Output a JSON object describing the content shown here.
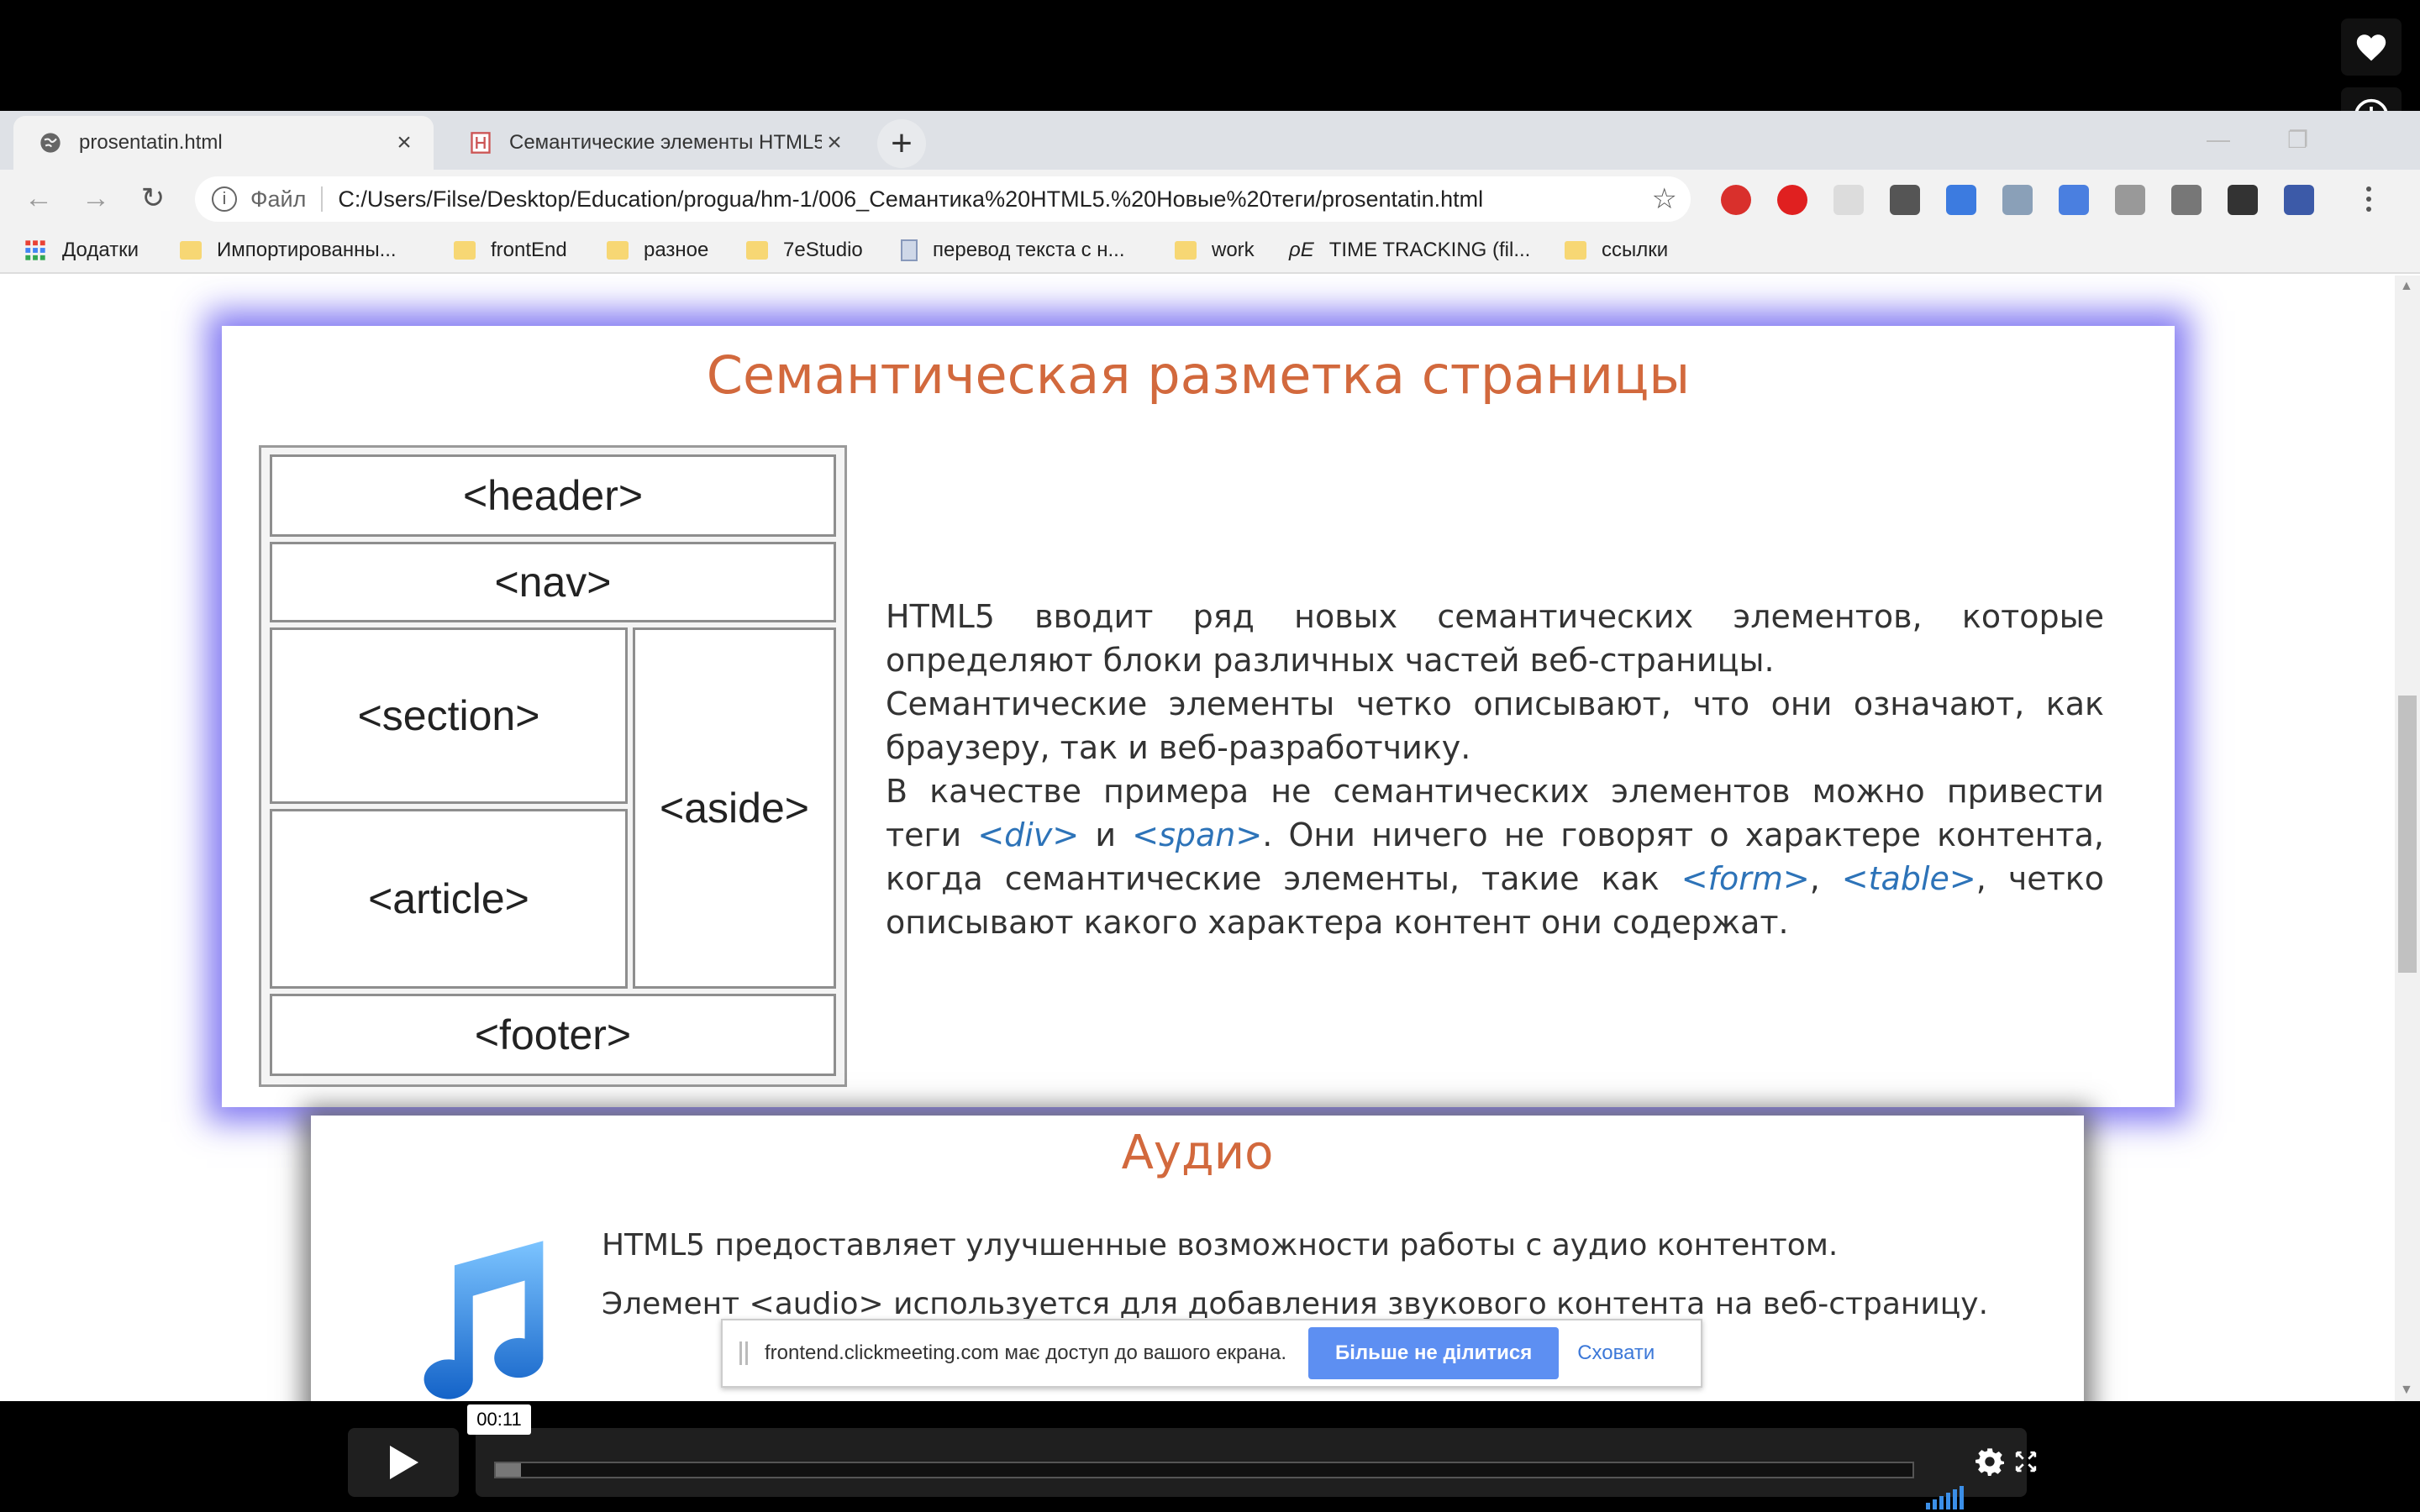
{
  "browser": {
    "tabs": [
      {
        "title": "prosentatin.html",
        "close": "×"
      },
      {
        "title": "Семантические элементы HTML5",
        "close": "×"
      }
    ],
    "new_tab": "+",
    "window_controls": {
      "minimize": "—",
      "restore": "❐"
    },
    "nav": {
      "back": "←",
      "forward": "→",
      "reload": "↻"
    },
    "address": {
      "info": "i",
      "scheme": "Файл",
      "url": "C:/Users/Filse/Desktop/Education/progua/hm-1/006_Семантика%20HTML5.%20Новые%20теги/prosentatin.html",
      "star": "☆"
    },
    "extensions": [
      {
        "name": "adblock-icon",
        "color": "#d9302c"
      },
      {
        "name": "opera-icon",
        "color": "#e02020"
      },
      {
        "name": "ext-grid-icon",
        "color": "#dcdcdc"
      },
      {
        "name": "qr-icon",
        "color": "#555555"
      },
      {
        "name": "translate-icon",
        "color": "#3c7be0"
      },
      {
        "name": "eye-icon",
        "color": "#8aa0b8"
      },
      {
        "name": "google-translate-icon",
        "color": "#4a7fe0"
      },
      {
        "name": "download-icon",
        "color": "#999999"
      },
      {
        "name": "id-icon",
        "color": "#777777"
      },
      {
        "name": "ut-icon",
        "color": "#333333"
      },
      {
        "name": "music-ext-icon",
        "color": "#3c5aa8"
      },
      {
        "name": "menu-icon",
        "color": "#555555"
      }
    ],
    "bookmarks": [
      {
        "label": "Додатки",
        "icon": "apps-icon"
      },
      {
        "label": "Импортированны...",
        "icon": "folder-icon"
      },
      {
        "label": "frontEnd",
        "icon": "folder-icon"
      },
      {
        "label": "разное",
        "icon": "folder-icon"
      },
      {
        "label": "7eStudio",
        "icon": "folder-icon"
      },
      {
        "label": "перевод текста с н...",
        "icon": "page-icon"
      },
      {
        "label": "work",
        "icon": "folder-icon"
      },
      {
        "label": "TIME TRACKING (fil...",
        "icon": "pe-icon",
        "icon_text": "ρE"
      },
      {
        "label": "ссылки",
        "icon": "folder-icon"
      }
    ]
  },
  "slide1": {
    "title": "Семантическая разметка страницы",
    "diagram": {
      "header": "<header>",
      "nav": "<nav>",
      "section": "<section>",
      "aside": "<aside>",
      "article": "<article>",
      "footer": "<footer>"
    },
    "paragraph": {
      "p1": "HTML5 вводит ряд новых семантических элементов, которые определяют блоки различных частей веб-страницы.",
      "p2": "Семантические элементы четко описывают, что они означают, как браузеру, так и веб-разработчику.",
      "p3_a": "В качестве примера не семантических элементов можно привести теги ",
      "tag_div": "<div>",
      "p3_b": " и ",
      "tag_span": "<span>",
      "p3_c": ". Они ничего не говорят о характере контента, когда семантические элементы, такие как ",
      "tag_form": "<form>",
      "p3_d": ", ",
      "tag_table": "<table>",
      "p3_e": ", четко описывают какого характера контент они содержат."
    }
  },
  "slide2": {
    "title": "Аудио",
    "line1": "HTML5 предоставляет улучшенные возможности работы с аудио контентом.",
    "line2": "Элемент <audio> используется для добавления звукового контента на веб-страницу."
  },
  "sharebar": {
    "message": "frontend.clickmeeting.com має доступ до вашого екрана.",
    "stop": "Більше не ділитися",
    "hide": "Сховати"
  },
  "player": {
    "time": "00:11",
    "progress": 0.018
  },
  "colors": {
    "accent_title": "#d2693d",
    "tag_blue": "#2d73b8",
    "slide_glow": "#6e64f0"
  }
}
